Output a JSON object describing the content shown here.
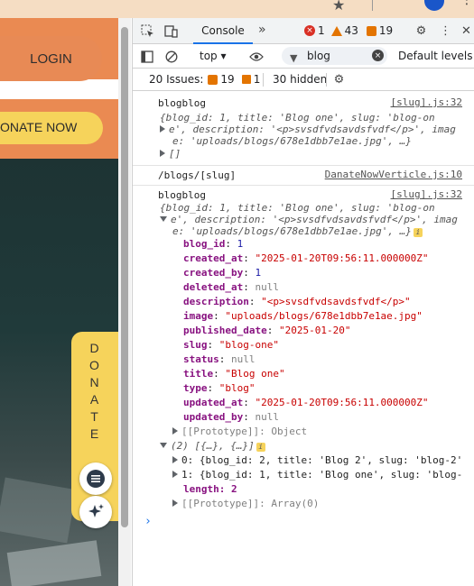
{
  "page": {
    "login_label": "LOGIN",
    "donate_now_label": "ONATE NOW",
    "donate_vertical_letters": [
      "D",
      "O",
      "N",
      "A",
      "T",
      "E"
    ]
  },
  "devtools": {
    "tab_console": "Console",
    "error_count": "1",
    "warning_count": "43",
    "issue_count_badge": "19",
    "context": "top",
    "filter_value": "blog",
    "levels": "Default levels",
    "issues_label": "20 Issues:",
    "issues_flag_count": "19",
    "issues_info_count": "1",
    "hidden": "30 hidden"
  },
  "console": {
    "msg1": {
      "label": "blogblog",
      "source": "[slug].js:32",
      "preview_1": "{blog_id: 1, title: 'Blog one', slug: 'blog-on",
      "preview_2": "e', description: '<p>svsdfvdsavdsfvdf</p>', imag",
      "preview_3": "e: 'uploads/blogs/678e1dbb7e1ae.jpg', …}",
      "array": "[]"
    },
    "msg2": {
      "text": "/blogs/[slug]",
      "source": "DanateNowVerticle.js:10"
    },
    "msg3": {
      "label": "blogblog",
      "source": "[slug].js:32",
      "preview_1": "{blog_id: 1, title: 'Blog one', slug: 'blog-on",
      "preview_2": "e', description: '<p>svsdfvdsavdsfvdf</p>', imag",
      "preview_3": "e: 'uploads/blogs/678e1dbb7e1ae.jpg', …}",
      "props": [
        {
          "key": "blog_id",
          "value": "1",
          "kind": "num"
        },
        {
          "key": "created_at",
          "value": "\"2025-01-20T09:56:11.000000Z\"",
          "kind": "str"
        },
        {
          "key": "created_by",
          "value": "1",
          "kind": "num"
        },
        {
          "key": "deleted_at",
          "value": "null",
          "kind": "null"
        },
        {
          "key": "description",
          "value": "\"<p>svsdfvdsavdsfvdf</p>\"",
          "kind": "str"
        },
        {
          "key": "image",
          "value": "\"uploads/blogs/678e1dbb7e1ae.jpg\"",
          "kind": "str"
        },
        {
          "key": "published_date",
          "value": "\"2025-01-20\"",
          "kind": "str"
        },
        {
          "key": "slug",
          "value": "\"blog-one\"",
          "kind": "str"
        },
        {
          "key": "status",
          "value": "null",
          "kind": "null"
        },
        {
          "key": "title",
          "value": "\"Blog one\"",
          "kind": "str"
        },
        {
          "key": "type",
          "value": "\"blog\"",
          "kind": "str"
        },
        {
          "key": "updated_at",
          "value": "\"2025-01-20T09:56:11.000000Z\"",
          "kind": "str"
        },
        {
          "key": "updated_by",
          "value": "null",
          "kind": "null"
        }
      ],
      "prototype": "[[Prototype]]: Object",
      "array_header": "(2) [{…}, {…}]",
      "item0": "0: {blog_id: 2, title: 'Blog 2', slug: 'blog-2'",
      "item1": "1: {blog_id: 1, title: 'Blog one', slug: 'blog-",
      "length": "length: 2",
      "array_prototype": "[[Prototype]]: Array(0)"
    },
    "prompt": "›"
  }
}
